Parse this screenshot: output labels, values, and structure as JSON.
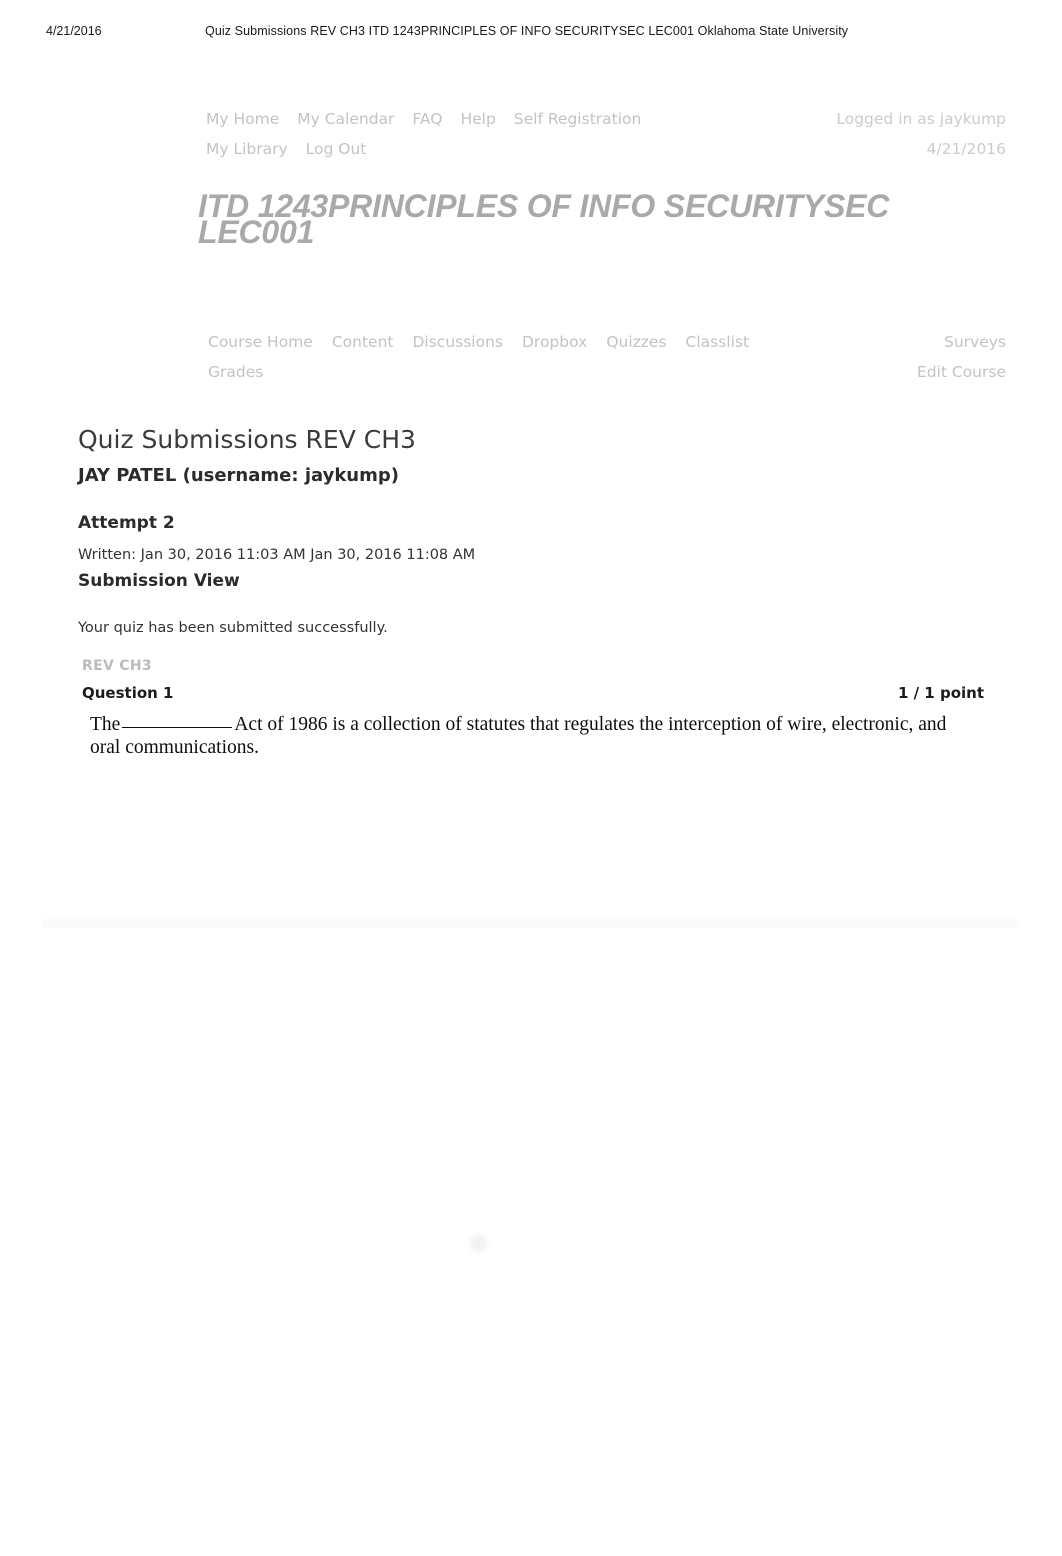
{
  "print_header": {
    "date": "4/21/2016",
    "title": "Quiz Submissions  REV CH3  ITD 1243PRINCIPLES OF INFO SECURITYSEC LEC001  Oklahoma State University"
  },
  "utility_nav": {
    "row1": [
      {
        "label": "My Home",
        "name": "nav-my-home"
      },
      {
        "label": "My Calendar",
        "name": "nav-my-calendar"
      },
      {
        "label": "FAQ",
        "name": "nav-faq"
      },
      {
        "label": "Help",
        "name": "nav-help"
      },
      {
        "label": "Self Registration",
        "name": "nav-self-registration"
      }
    ],
    "row2": [
      {
        "label": "My Library",
        "name": "nav-my-library"
      },
      {
        "label": "Log Out",
        "name": "nav-log-out"
      }
    ],
    "logged_in_as": "Logged in as jaykump",
    "date": "4/21/2016"
  },
  "course": {
    "title": "ITD 1243PRINCIPLES OF INFO SECURITYSEC LEC001"
  },
  "course_nav": {
    "row1": [
      {
        "label": "Course Home",
        "name": "tab-course-home"
      },
      {
        "label": "Content",
        "name": "tab-content"
      },
      {
        "label": "Discussions",
        "name": "tab-discussions"
      },
      {
        "label": "Dropbox",
        "name": "tab-dropbox"
      },
      {
        "label": "Quizzes",
        "name": "tab-quizzes"
      },
      {
        "label": "Classlist",
        "name": "tab-classlist"
      }
    ],
    "row1_right": "Surveys",
    "row2": [
      {
        "label": "Grades",
        "name": "tab-grades"
      }
    ],
    "row2_right": "Edit Course"
  },
  "main": {
    "page_heading": "Quiz Submissions  REV CH3",
    "student": "JAY PATEL (username: jaykump)",
    "attempt": "Attempt 2",
    "written": "Written: Jan 30, 2016 11:03 AM  Jan 30, 2016 11:08 AM",
    "submission_view": "Submission View",
    "success_message": "Your quiz has been submitted successfully.",
    "quiz_label": "REV CH3",
    "question": {
      "number": "Question 1",
      "points": "1 / 1 point",
      "text_before_blank": "The",
      "text_after_blank": "Act of 1986 is a collection of statutes that regulates the interception of wire, electronic, and oral communications."
    }
  },
  "colors": {
    "nav_gray": "#c3c3c3",
    "title_gray": "#a9a9a9",
    "heading_dark": "#3b3b3b",
    "body_text": "#333333",
    "quiz_label_gray": "#bbbbbb",
    "page_background": "#ffffff"
  }
}
